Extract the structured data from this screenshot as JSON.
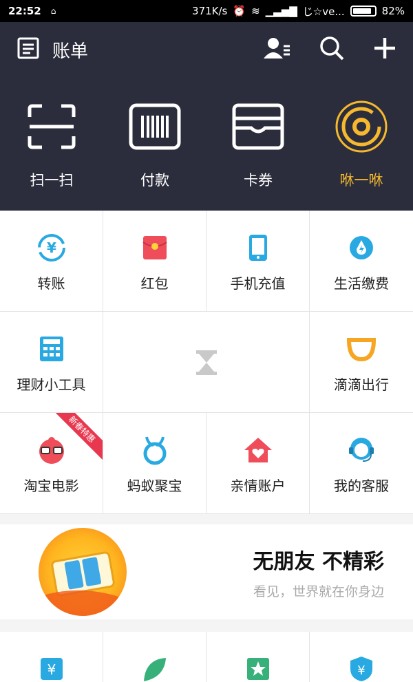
{
  "status": {
    "time": "22:52",
    "speed": "371K/s",
    "carrier": "じ☆ve...",
    "battery": "82%"
  },
  "header": {
    "title": "账单",
    "quick": [
      {
        "label": "扫一扫",
        "icon": "scan-icon"
      },
      {
        "label": "付款",
        "icon": "barcode-icon"
      },
      {
        "label": "卡券",
        "icon": "wallet-icon"
      },
      {
        "label": "咻一咻",
        "icon": "xiu-icon"
      }
    ]
  },
  "grid": [
    [
      {
        "label": "转账",
        "icon": "transfer-icon",
        "color": "#29a9e1"
      },
      {
        "label": "红包",
        "icon": "red-envelope-icon",
        "color": "#ef4d5a"
      },
      {
        "label": "手机充值",
        "icon": "phone-icon",
        "color": "#29a9e1"
      },
      {
        "label": "生活缴费",
        "icon": "water-drop-icon",
        "color": "#29a9e1"
      }
    ],
    [
      {
        "label": "理财小工具",
        "icon": "calculator-icon",
        "color": "#29a9e1"
      },
      {
        "label": "",
        "icon": "hourglass-icon",
        "color": "#c9c9c9"
      },
      {
        "label": "滴滴出行",
        "icon": "didi-icon",
        "color": "#f6a623"
      }
    ],
    [
      {
        "label": "淘宝电影",
        "icon": "movie-icon",
        "color": "#ef4d5a",
        "ribbon": "新春特惠"
      },
      {
        "label": "蚂蚁聚宝",
        "icon": "ant-fortune-icon",
        "color": "#29a9e1"
      },
      {
        "label": "亲情账户",
        "icon": "family-house-icon",
        "color": "#ef4d5a"
      },
      {
        "label": "我的客服",
        "icon": "customer-service-icon",
        "color": "#29a9e1"
      }
    ]
  ],
  "banner": {
    "title": "无朋友 不精彩",
    "subtitle": "看见，世界就在你身边"
  }
}
